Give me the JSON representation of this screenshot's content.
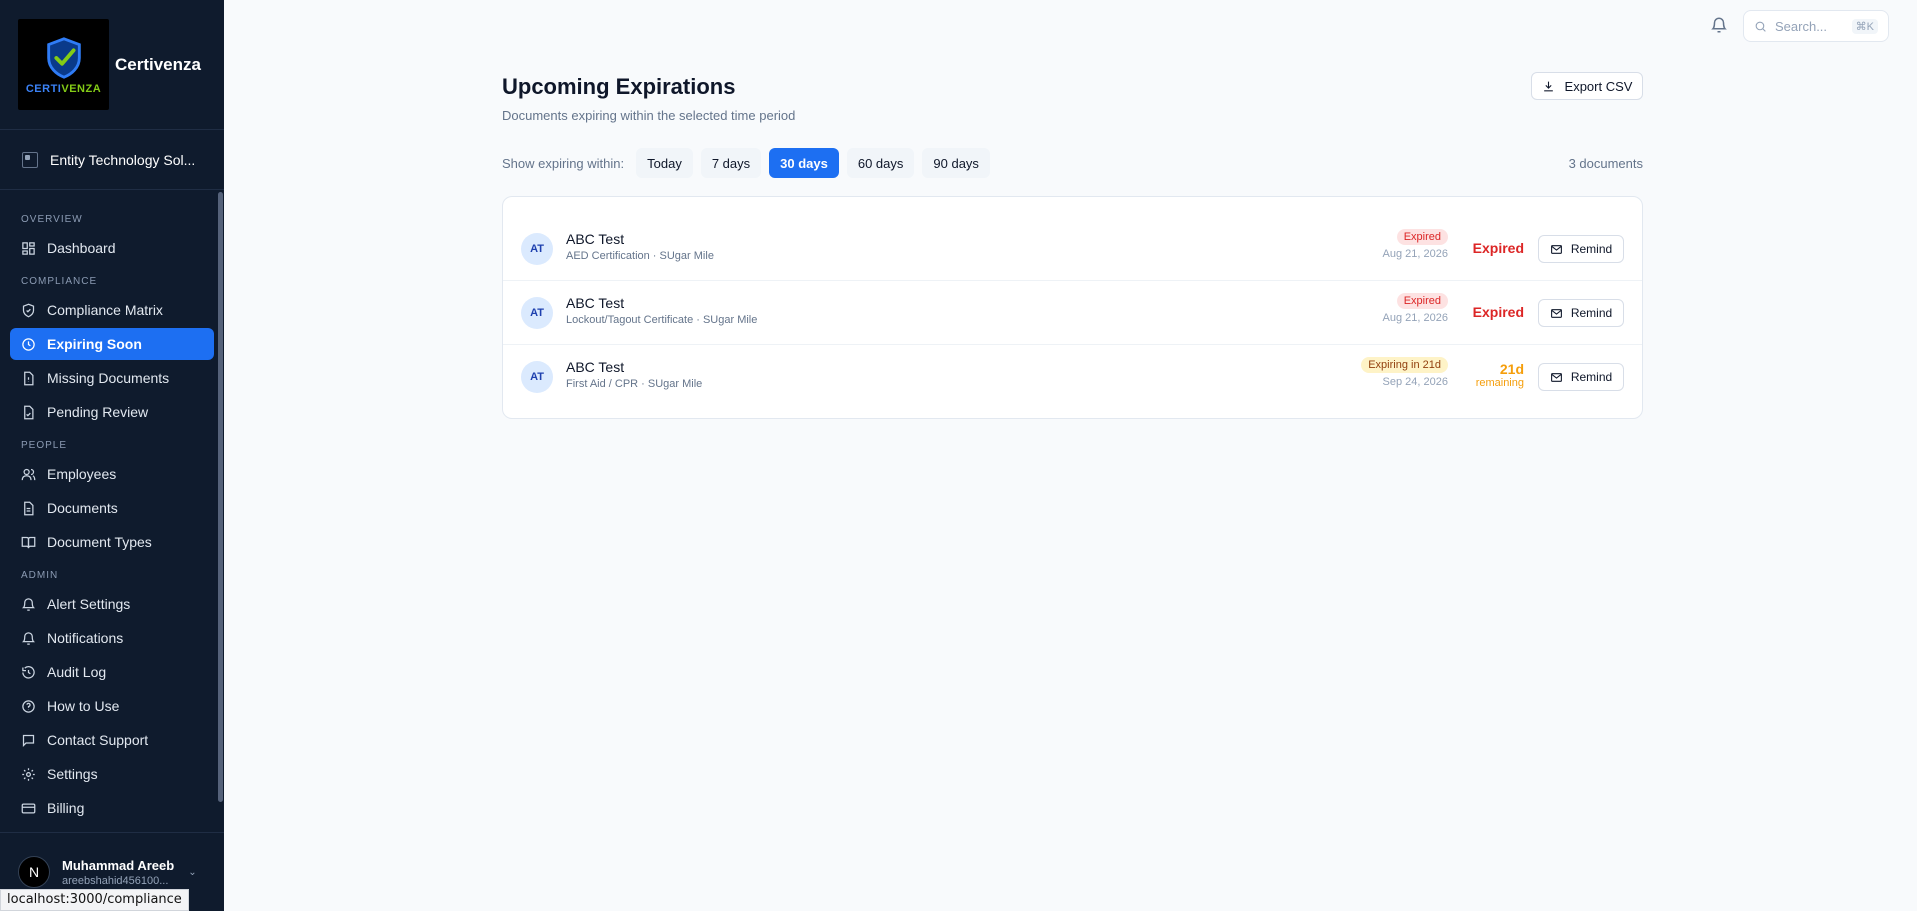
{
  "brand": {
    "name": "Certivenza",
    "logo_text_a": "CERTI",
    "logo_text_b": "VENZA"
  },
  "org": {
    "name": "Entity Technology Sol..."
  },
  "nav": {
    "overview_label": "OVERVIEW",
    "compliance_label": "COMPLIANCE",
    "people_label": "PEOPLE",
    "admin_label": "ADMIN",
    "dashboard": "Dashboard",
    "compliance_matrix": "Compliance Matrix",
    "expiring_soon": "Expiring Soon",
    "missing_documents": "Missing Documents",
    "pending_review": "Pending Review",
    "employees": "Employees",
    "documents": "Documents",
    "document_types": "Document Types",
    "alert_settings": "Alert Settings",
    "notifications": "Notifications",
    "audit_log": "Audit Log",
    "how_to_use": "How to Use",
    "contact_support": "Contact Support",
    "settings": "Settings",
    "billing": "Billing"
  },
  "user": {
    "initial": "N",
    "name": "Muhammad Areeb",
    "email": "areebshahid456100..."
  },
  "status_url": "localhost:3000/compliance",
  "search": {
    "placeholder": "Search...",
    "shortcut": "⌘K"
  },
  "page": {
    "title": "Upcoming Expirations",
    "subtitle": "Documents expiring within the selected time period",
    "export_label": "Export CSV",
    "filter_label": "Show expiring within:",
    "filters": [
      "Today",
      "7 days",
      "30 days",
      "60 days",
      "90 days"
    ],
    "active_filter": "30 days",
    "doc_count": "3 documents"
  },
  "rows": [
    {
      "initials": "AT",
      "name": "ABC Test",
      "sub": "AED Certification · SUgar Mile",
      "badge": "Expired",
      "date": "Aug 21, 2026",
      "status": "Expired",
      "remind": "Remind"
    },
    {
      "initials": "AT",
      "name": "ABC Test",
      "sub": "Lockout/Tagout Certificate · SUgar Mile",
      "badge": "Expired",
      "date": "Aug 21, 2026",
      "status": "Expired",
      "remind": "Remind"
    },
    {
      "initials": "AT",
      "name": "ABC Test",
      "sub": "First Aid / CPR · SUgar Mile",
      "badge": "Expiring in 21d",
      "date": "Sep 24, 2026",
      "days": "21d",
      "days_label": "remaining",
      "remind": "Remind"
    }
  ],
  "colors": {
    "accent": "#1d6ff2",
    "sidebar": "#0f1b2d",
    "expired": "#dc2626",
    "warning": "#f59e0b"
  }
}
